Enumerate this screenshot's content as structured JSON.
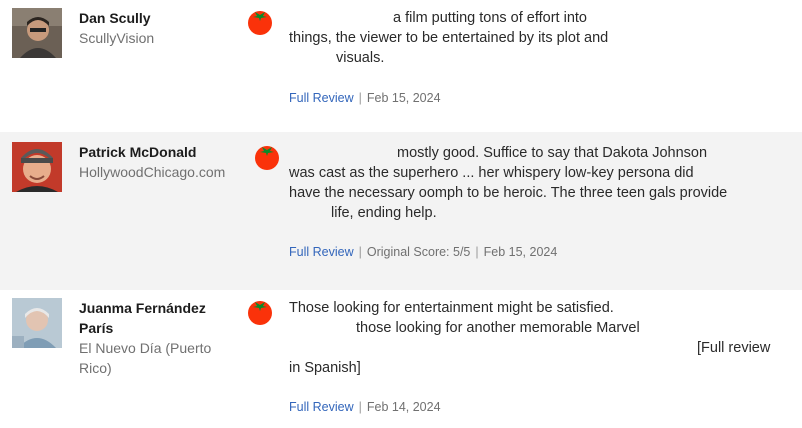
{
  "reviews": [
    {
      "critic_name": "Dan Scully",
      "publication": "ScullyVision",
      "rating_icon": "fresh-tomato-icon",
      "quote_lines": [
        "a film putting tons of effort into",
        "things, the viewer to be entertained by its plot and",
        "visuals."
      ],
      "full_review_label": "Full Review",
      "original_score": "",
      "date": "Feb 15, 2024"
    },
    {
      "critic_name": "Patrick McDonald",
      "publication": "HollywoodChicago.com",
      "rating_icon": "fresh-tomato-icon",
      "quote_lines": [
        "mostly good. Suffice to say that Dakota Johnson",
        "was cast as the superhero ... her whispery low-key persona did",
        "have the necessary oomph to be heroic. The three teen gals provide",
        "life, ending help."
      ],
      "full_review_label": "Full Review",
      "original_score": "Original Score: 5/5",
      "date": "Feb 15, 2024"
    },
    {
      "critic_name": "Juanma Fernández París",
      "publication": "El Nuevo Día (Puerto Rico)",
      "rating_icon": "fresh-tomato-icon",
      "quote_lines": [
        "Those looking for entertainment might be satisfied.",
        "those looking for another memorable Marvel",
        "[Full review",
        "in Spanish]"
      ],
      "full_review_label": "Full Review",
      "original_score": "",
      "date": "Feb 14, 2024"
    }
  ],
  "colors": {
    "link": "#3366bb",
    "tomato": "#fa320a",
    "alt_row": "#f3f3f3"
  }
}
